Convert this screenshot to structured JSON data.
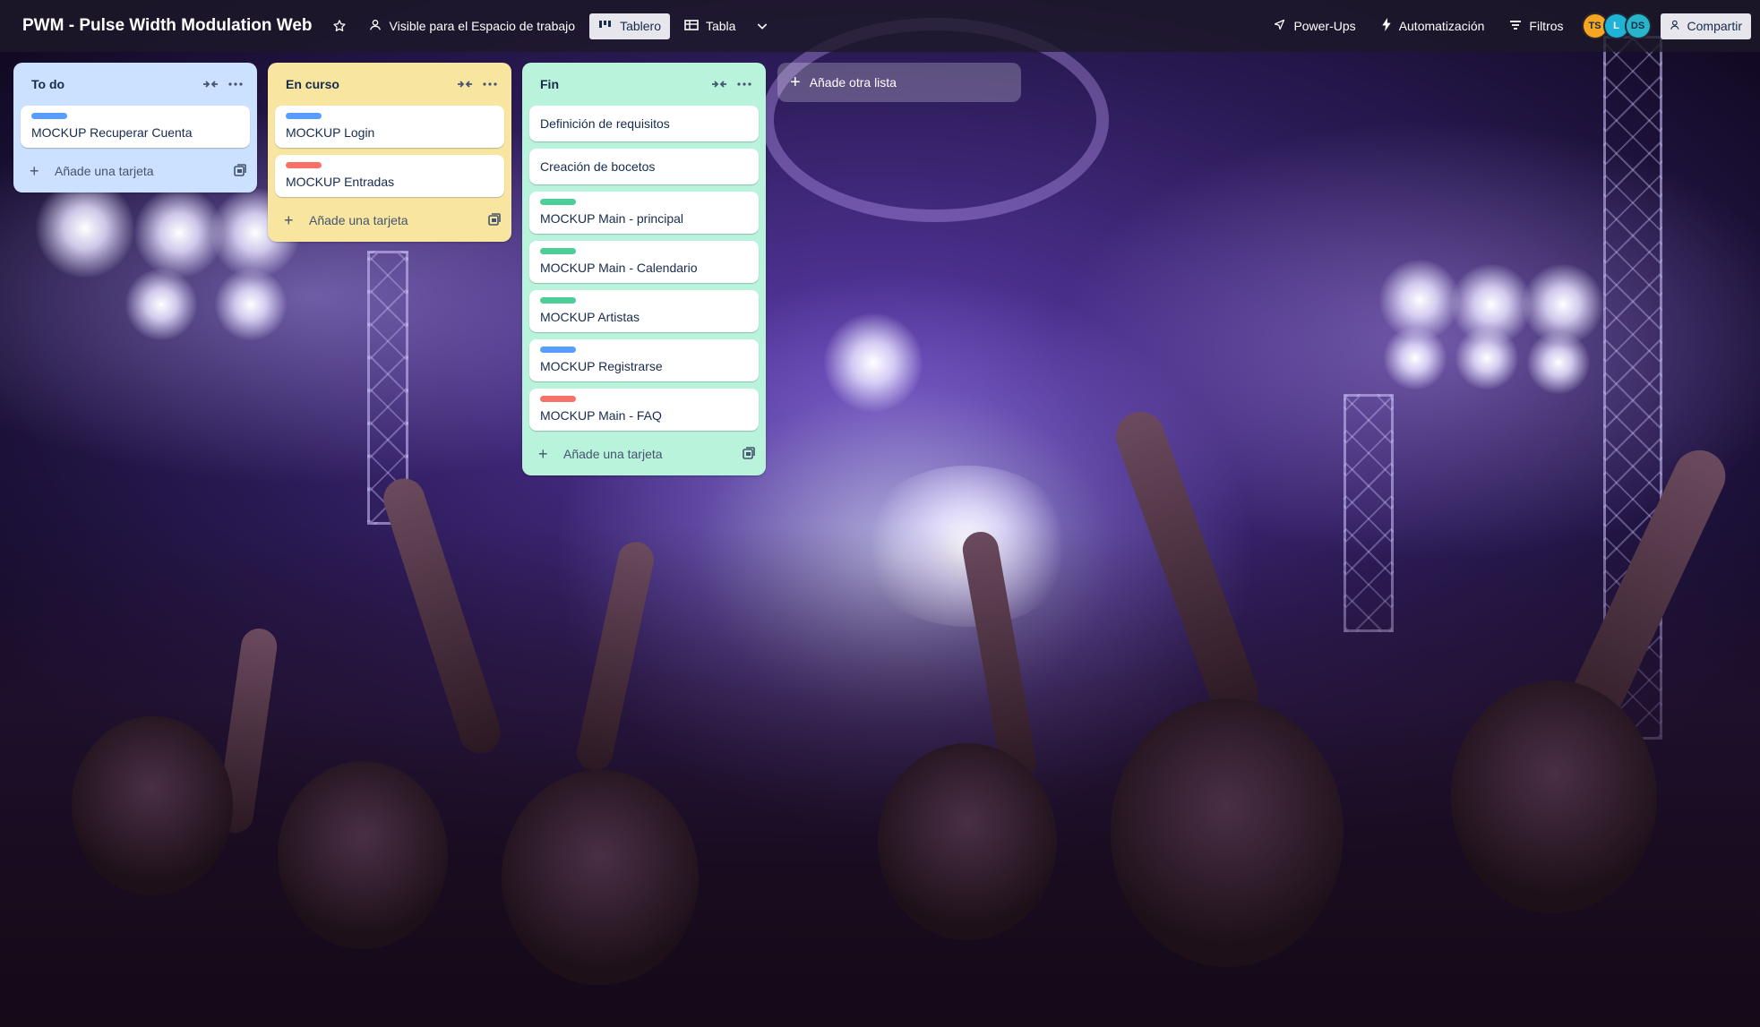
{
  "board": {
    "title": "PWM - Pulse Width Modulation Web",
    "visibility": "Visible para el Espacio de trabajo",
    "views": [
      {
        "label": "Tablero",
        "icon": "board-icon",
        "active": true
      },
      {
        "label": "Tabla",
        "icon": "table-icon",
        "active": false
      }
    ]
  },
  "header_right": {
    "powerups": "Power-Ups",
    "automation": "Automatización",
    "filters": "Filtros",
    "share": "Compartir",
    "members": [
      {
        "initials": "TS",
        "color": "#f5a623"
      },
      {
        "initials": "L",
        "color": "#1fb3d6"
      },
      {
        "initials": "DS",
        "color": "#29b5c9"
      }
    ]
  },
  "colors": {
    "label_blue": "#579dff",
    "label_red": "#f87168",
    "label_green": "#4bce97",
    "list_todo": "#cce0ff",
    "list_en_curso": "#f8e6a0",
    "list_fin": "#baf3db"
  },
  "lists": [
    {
      "title": "To do",
      "cards": [
        {
          "title": "MOCKUP Recuperar Cuenta",
          "label": "blue"
        }
      ],
      "add_card": "Añade una tarjeta"
    },
    {
      "title": "En curso",
      "cards": [
        {
          "title": "MOCKUP Login",
          "label": "blue"
        },
        {
          "title": "MOCKUP Entradas",
          "label": "red"
        }
      ],
      "add_card": "Añade una tarjeta"
    },
    {
      "title": "Fin",
      "cards": [
        {
          "title": "Definición de requisitos",
          "label": null
        },
        {
          "title": "Creación de bocetos",
          "label": null
        },
        {
          "title": "MOCKUP Main - principal",
          "label": "green"
        },
        {
          "title": "MOCKUP Main - Calendario",
          "label": "green"
        },
        {
          "title": "MOCKUP Artistas",
          "label": "green"
        },
        {
          "title": "MOCKUP Registrarse",
          "label": "blue"
        },
        {
          "title": "MOCKUP Main - FAQ",
          "label": "red"
        }
      ],
      "add_card": "Añade una tarjeta"
    }
  ],
  "add_list": "Añade otra lista"
}
